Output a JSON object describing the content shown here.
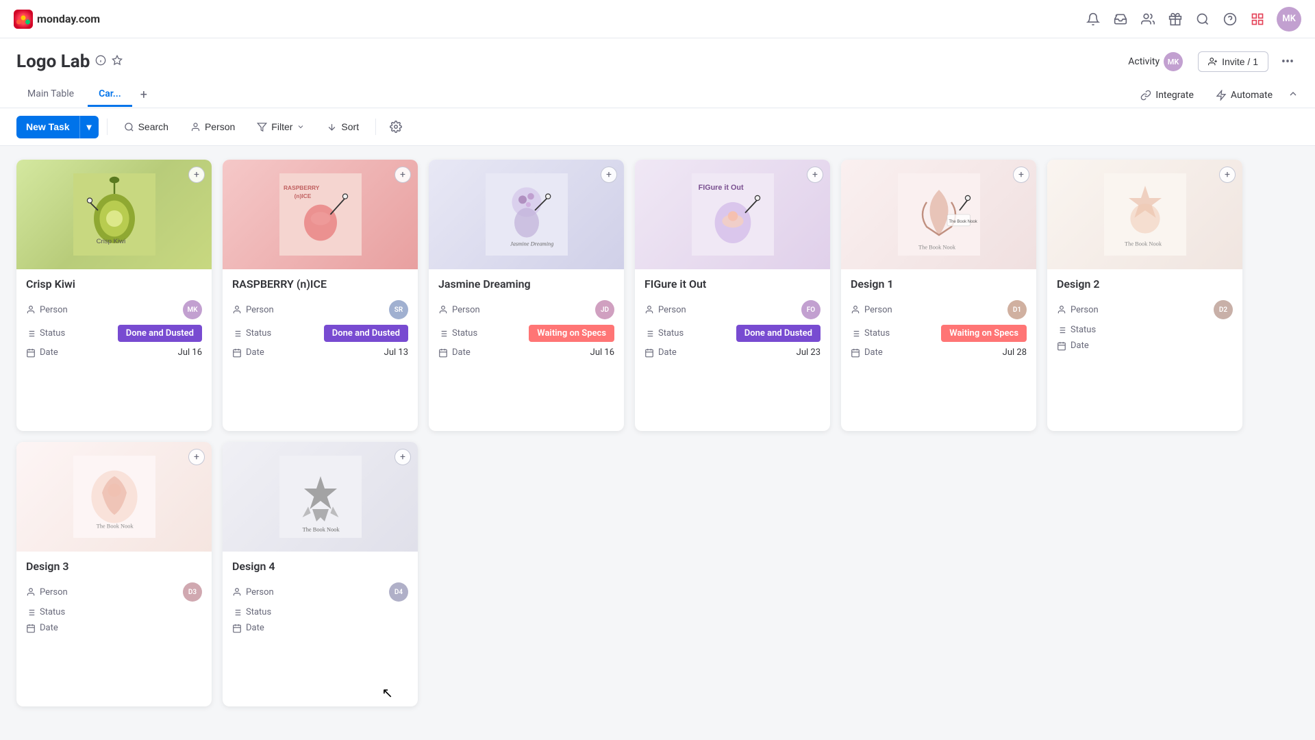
{
  "app": {
    "name": "monday.com"
  },
  "board": {
    "title": "Logo Lab",
    "tabs": [
      {
        "id": "main-table",
        "label": "Main Table",
        "active": false
      },
      {
        "id": "cards",
        "label": "Car...",
        "active": true
      }
    ],
    "activity_label": "Activity",
    "invite_label": "Invite / 1",
    "integrate_label": "Integrate",
    "automate_label": "Automate"
  },
  "toolbar": {
    "new_task_label": "New Task",
    "search_label": "Search",
    "person_label": "Person",
    "filter_label": "Filter",
    "sort_label": "Sort"
  },
  "nav_icons": {
    "bell": "🔔",
    "inbox": "📥",
    "people": "👥",
    "gift": "🎁",
    "search": "🔍",
    "help": "❓"
  },
  "cards": [
    {
      "id": "crisp-kiwi",
      "title": "Crisp Kiwi",
      "image_class": "img-crisp-kiwi",
      "person_initials": "MK",
      "person_color": "#c2a0d0",
      "status": "Done and Dusted",
      "status_class": "status-done",
      "date": "Jul 16",
      "field_person": "Person",
      "field_status": "Status",
      "field_date": "Date"
    },
    {
      "id": "raspberry",
      "title": "RASPBERRY (n)ICE",
      "image_class": "img-raspberry",
      "person_initials": "SR",
      "person_color": "#a0b0d0",
      "status": "Done and Dusted",
      "status_class": "status-done",
      "date": "Jul 13",
      "field_person": "Person",
      "field_status": "Status",
      "field_date": "Date"
    },
    {
      "id": "jasmine-dreaming",
      "title": "Jasmine Dreaming",
      "image_class": "img-jasmine",
      "person_initials": "JD",
      "person_color": "#d0a0c0",
      "status": "Waiting on Specs",
      "status_class": "status-waiting",
      "date": "Jul 16",
      "field_person": "Person",
      "field_status": "Status",
      "field_date": "Date"
    },
    {
      "id": "figure-it-out",
      "title": "FIGure it Out",
      "image_class": "img-figure",
      "person_initials": "FO",
      "person_color": "#c2a0d0",
      "status": "Done and Dusted",
      "status_class": "status-done",
      "date": "Jul 23",
      "field_person": "Person",
      "field_status": "Status",
      "field_date": "Date"
    },
    {
      "id": "design-1",
      "title": "Design 1",
      "image_class": "img-design1",
      "person_initials": "D1",
      "person_color": "#d0b0a0",
      "status": "Waiting on Specs",
      "status_class": "status-waiting",
      "date": "Jul 28",
      "field_person": "Person",
      "field_status": "Status",
      "field_date": "Date"
    },
    {
      "id": "design-2",
      "title": "Design 2",
      "image_class": "img-design2",
      "person_initials": "D2",
      "person_color": "#c8b0a8",
      "status": "",
      "status_class": "",
      "date": "",
      "field_person": "Person",
      "field_status": "Status",
      "field_date": "Date"
    },
    {
      "id": "design-3",
      "title": "Design 3",
      "image_class": "img-design3",
      "person_initials": "D3",
      "person_color": "#d0a8b0",
      "status": "",
      "status_class": "",
      "date": "",
      "field_person": "Person",
      "field_status": "Status",
      "field_date": "Date"
    },
    {
      "id": "design-4",
      "title": "Design 4",
      "image_class": "img-design4",
      "person_initials": "D4",
      "person_color": "#b0b0c8",
      "status": "",
      "status_class": "",
      "date": "",
      "field_person": "Person",
      "field_status": "Status",
      "field_date": "Date"
    }
  ],
  "colors": {
    "primary": "#0073ea",
    "done": "#784bd1",
    "waiting": "#ff7575",
    "text_main": "#323338",
    "text_secondary": "#676879",
    "border": "#e6e9ef",
    "bg": "#f5f6f8"
  }
}
